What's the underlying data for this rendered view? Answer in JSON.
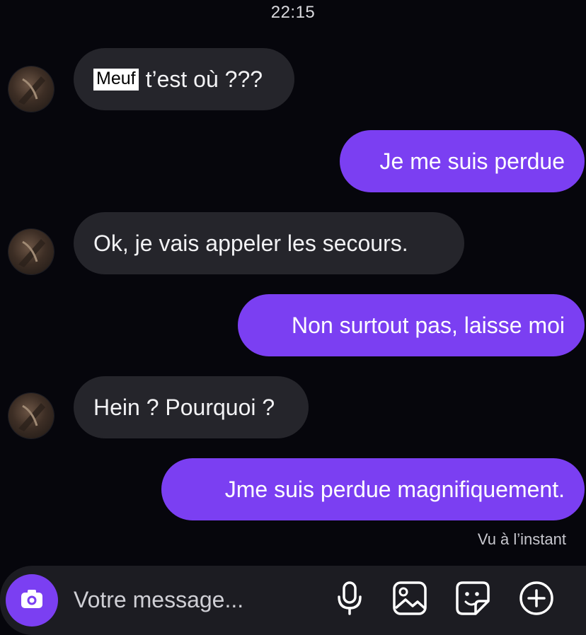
{
  "status": {
    "time": "22:15"
  },
  "messages": [
    {
      "side": "received",
      "sticker": "Meuf",
      "text": "t’est où ???"
    },
    {
      "side": "sent",
      "text": "Je me suis perdue"
    },
    {
      "side": "received",
      "text": "Ok, je vais appeler les secours."
    },
    {
      "side": "sent",
      "text": "Non surtout pas, laisse moi"
    },
    {
      "side": "received",
      "text": "Hein ? Pourquoi ?"
    },
    {
      "side": "sent",
      "text": "Jme suis perdue magnifiquement."
    }
  ],
  "read_receipt": "Vu à l’instant",
  "composer": {
    "placeholder": "Votre message...",
    "icons": [
      "camera-icon",
      "microphone-icon",
      "image-icon",
      "sticker-icon",
      "plus-circle-icon"
    ]
  },
  "colors": {
    "background": "#06060c",
    "sent_bubble": "#7b3ff2",
    "received_bubble": "#25252b",
    "composer": "#1c1c22"
  }
}
